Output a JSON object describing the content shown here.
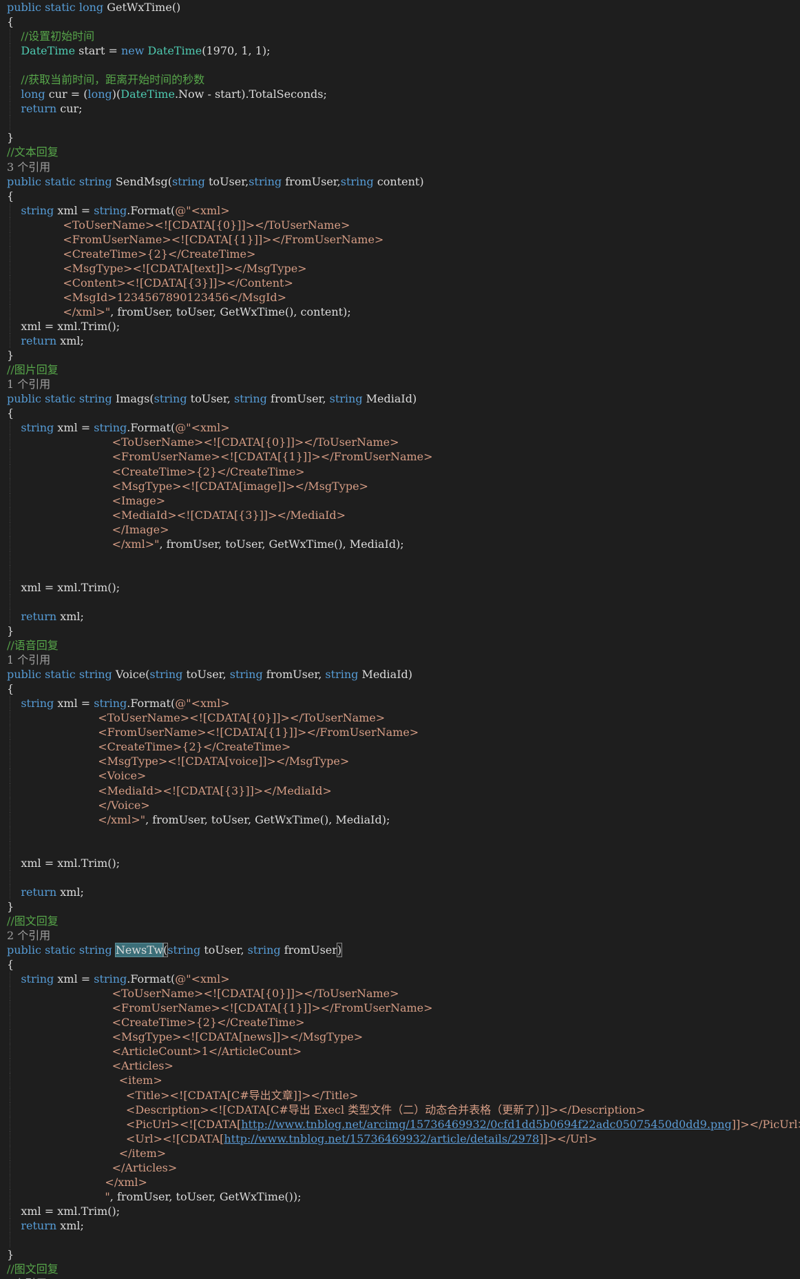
{
  "lines": [
    [
      [
        "kw",
        "public static long "
      ],
      [
        "",
        "GetWxTime()"
      ]
    ],
    [
      [
        "",
        "{"
      ]
    ],
    [
      [
        "cm",
        "    //设置初始时间"
      ]
    ],
    [
      [
        "ty",
        "    DateTime "
      ],
      [
        "",
        "start = "
      ],
      [
        "kw",
        "new "
      ],
      [
        "ty",
        "DateTime"
      ],
      [
        "",
        "(1970, 1, 1);"
      ]
    ],
    [
      [
        "",
        ""
      ]
    ],
    [
      [
        "cm",
        "    //获取当前时间，距离开始时间的秒数"
      ]
    ],
    [
      [
        "kw",
        "    long "
      ],
      [
        "",
        "cur = ("
      ],
      [
        "kw",
        "long"
      ],
      [
        "",
        ")("
      ],
      [
        "ty",
        "DateTime"
      ],
      [
        "",
        ".Now - start).TotalSeconds;"
      ]
    ],
    [
      [
        "kw",
        "    return "
      ],
      [
        "",
        "cur;"
      ]
    ],
    [
      [
        "",
        ""
      ]
    ],
    [
      [
        "",
        "}"
      ]
    ],
    [
      [
        "cm",
        "//文本回复"
      ]
    ],
    [
      [
        "cl",
        "3 个引用"
      ]
    ],
    [
      [
        "kw",
        "public static string "
      ],
      [
        "",
        "SendMsg("
      ],
      [
        "kw",
        "string "
      ],
      [
        "",
        "toUser,"
      ],
      [
        "kw",
        "string "
      ],
      [
        "",
        "fromUser,"
      ],
      [
        "kw",
        "string "
      ],
      [
        "",
        "content)"
      ]
    ],
    [
      [
        "",
        "{"
      ]
    ],
    [
      [
        "kw",
        "    string "
      ],
      [
        "",
        "xml = "
      ],
      [
        "kw",
        "string"
      ],
      [
        "",
        ".Format("
      ],
      [
        "st",
        "@\"<xml>"
      ]
    ],
    [
      [
        "st",
        "                <ToUserName><![CDATA[{0}]]></ToUserName>"
      ]
    ],
    [
      [
        "st",
        "                <FromUserName><![CDATA[{1}]]></FromUserName>"
      ]
    ],
    [
      [
        "st",
        "                <CreateTime>{2}</CreateTime>"
      ]
    ],
    [
      [
        "st",
        "                <MsgType><![CDATA[text]]></MsgType>"
      ]
    ],
    [
      [
        "st",
        "                <Content><![CDATA[{3}]]></Content>"
      ]
    ],
    [
      [
        "st",
        "                <MsgId>1234567890123456</MsgId>"
      ]
    ],
    [
      [
        "st",
        "                </xml>\""
      ],
      [
        "",
        ", fromUser, toUser, GetWxTime(), content);"
      ]
    ],
    [
      [
        "",
        "    xml = xml.Trim();"
      ]
    ],
    [
      [
        "kw",
        "    return "
      ],
      [
        "",
        "xml;"
      ]
    ],
    [
      [
        "",
        "}"
      ]
    ],
    [
      [
        "cm",
        "//图片回复"
      ]
    ],
    [
      [
        "cl",
        "1 个引用"
      ]
    ],
    [
      [
        "kw",
        "public static string "
      ],
      [
        "",
        "Imags("
      ],
      [
        "kw",
        "string "
      ],
      [
        "",
        "toUser, "
      ],
      [
        "kw",
        "string "
      ],
      [
        "",
        "fromUser, "
      ],
      [
        "kw",
        "string "
      ],
      [
        "",
        "MediaId)"
      ]
    ],
    [
      [
        "",
        "{"
      ]
    ],
    [
      [
        "kw",
        "    string "
      ],
      [
        "",
        "xml = "
      ],
      [
        "kw",
        "string"
      ],
      [
        "",
        ".Format("
      ],
      [
        "st",
        "@\"<xml>"
      ]
    ],
    [
      [
        "st",
        "                              <ToUserName><![CDATA[{0}]]></ToUserName>"
      ]
    ],
    [
      [
        "st",
        "                              <FromUserName><![CDATA[{1}]]></FromUserName>"
      ]
    ],
    [
      [
        "st",
        "                              <CreateTime>{2}</CreateTime>"
      ]
    ],
    [
      [
        "st",
        "                              <MsgType><![CDATA[image]]></MsgType>"
      ]
    ],
    [
      [
        "st",
        "                              <Image>"
      ]
    ],
    [
      [
        "st",
        "                              <MediaId><![CDATA[{3}]]></MediaId>"
      ]
    ],
    [
      [
        "st",
        "                              </Image>"
      ]
    ],
    [
      [
        "st",
        "                              </xml>\""
      ],
      [
        "",
        ", fromUser, toUser, GetWxTime(), MediaId);"
      ]
    ],
    [
      [
        "",
        ""
      ]
    ],
    [
      [
        "",
        ""
      ]
    ],
    [
      [
        "",
        "    xml = xml.Trim();"
      ]
    ],
    [
      [
        "",
        ""
      ]
    ],
    [
      [
        "kw",
        "    return "
      ],
      [
        "",
        "xml;"
      ]
    ],
    [
      [
        "",
        "}"
      ]
    ],
    [
      [
        "cm",
        "//语音回复"
      ]
    ],
    [
      [
        "cl",
        "1 个引用"
      ]
    ],
    [
      [
        "kw",
        "public static string "
      ],
      [
        "",
        "Voice("
      ],
      [
        "kw",
        "string "
      ],
      [
        "",
        "toUser, "
      ],
      [
        "kw",
        "string "
      ],
      [
        "",
        "fromUser, "
      ],
      [
        "kw",
        "string "
      ],
      [
        "",
        "MediaId)"
      ]
    ],
    [
      [
        "",
        "{"
      ]
    ],
    [
      [
        "kw",
        "    string "
      ],
      [
        "",
        "xml = "
      ],
      [
        "kw",
        "string"
      ],
      [
        "",
        ".Format("
      ],
      [
        "st",
        "@\"<xml>"
      ]
    ],
    [
      [
        "st",
        "                          <ToUserName><![CDATA[{0}]]></ToUserName>"
      ]
    ],
    [
      [
        "st",
        "                          <FromUserName><![CDATA[{1}]]></FromUserName>"
      ]
    ],
    [
      [
        "st",
        "                          <CreateTime>{2}</CreateTime>"
      ]
    ],
    [
      [
        "st",
        "                          <MsgType><![CDATA[voice]]></MsgType>"
      ]
    ],
    [
      [
        "st",
        "                          <Voice>"
      ]
    ],
    [
      [
        "st",
        "                          <MediaId><![CDATA[{3}]]></MediaId>"
      ]
    ],
    [
      [
        "st",
        "                          </Voice>"
      ]
    ],
    [
      [
        "st",
        "                          </xml>\""
      ],
      [
        "",
        ", fromUser, toUser, GetWxTime(), MediaId);"
      ]
    ],
    [
      [
        "",
        ""
      ]
    ],
    [
      [
        "",
        ""
      ]
    ],
    [
      [
        "",
        "    xml = xml.Trim();"
      ]
    ],
    [
      [
        "",
        ""
      ]
    ],
    [
      [
        "kw",
        "    return "
      ],
      [
        "",
        "xml;"
      ]
    ],
    [
      [
        "",
        "}"
      ]
    ],
    [
      [
        "cm",
        "//图文回复"
      ]
    ],
    [
      [
        "cl",
        "2 个引用"
      ]
    ],
    [
      [
        "kw",
        "public static string "
      ],
      [
        "sel",
        "NewsTw"
      ],
      [
        "brk",
        "("
      ],
      [
        "kw",
        "string "
      ],
      [
        "",
        "toUser, "
      ],
      [
        "kw",
        "string "
      ],
      [
        "",
        "fromUser"
      ],
      [
        "brk",
        ")"
      ]
    ],
    [
      [
        "",
        "{"
      ]
    ],
    [
      [
        "kw",
        "    string "
      ],
      [
        "",
        "xml = "
      ],
      [
        "kw",
        "string"
      ],
      [
        "",
        ".Format("
      ],
      [
        "st",
        "@\"<xml>"
      ]
    ],
    [
      [
        "st",
        "                              <ToUserName><![CDATA[{0}]]></ToUserName>"
      ]
    ],
    [
      [
        "st",
        "                              <FromUserName><![CDATA[{1}]]></FromUserName>"
      ]
    ],
    [
      [
        "st",
        "                              <CreateTime>{2}</CreateTime>"
      ]
    ],
    [
      [
        "st",
        "                              <MsgType><![CDATA[news]]></MsgType>"
      ]
    ],
    [
      [
        "st",
        "                              <ArticleCount>1</ArticleCount>"
      ]
    ],
    [
      [
        "st",
        "                              <Articles>"
      ]
    ],
    [
      [
        "st",
        "                                <item>"
      ]
    ],
    [
      [
        "st",
        "                                  <Title><![CDATA[C#导出文章]]></Title>"
      ]
    ],
    [
      [
        "st",
        "                                  <Description><![CDATA[C#导出 Execl 类型文件（二）动态合并表格（更新了）]]></Description>"
      ]
    ],
    [
      [
        "st",
        "                                  <PicUrl><![CDATA["
      ],
      [
        "ln",
        "http://www.tnblog.net/arcimg/15736469932/0cfd1dd5b0694f22adc05075450d0dd9.png"
      ],
      [
        "st",
        "]]></PicUrl>"
      ]
    ],
    [
      [
        "st",
        "                                  <Url><![CDATA["
      ],
      [
        "ln",
        "http://www.tnblog.net/15736469932/article/details/2978"
      ],
      [
        "st",
        "]]></Url>"
      ]
    ],
    [
      [
        "st",
        "                                </item>"
      ]
    ],
    [
      [
        "st",
        "                              </Articles>"
      ]
    ],
    [
      [
        "st",
        "                            </xml>"
      ]
    ],
    [
      [
        "st",
        "                            \""
      ],
      [
        "",
        ", fromUser, toUser, GetWxTime());"
      ]
    ],
    [
      [
        "",
        "    xml = xml.Trim();"
      ]
    ],
    [
      [
        "kw",
        "    return "
      ],
      [
        "",
        "xml;"
      ]
    ],
    [
      [
        "",
        ""
      ]
    ],
    [
      [
        "",
        "}"
      ]
    ],
    [
      [
        "cm",
        "//图文回复"
      ]
    ],
    [
      [
        "cl",
        "  个引用"
      ]
    ]
  ]
}
